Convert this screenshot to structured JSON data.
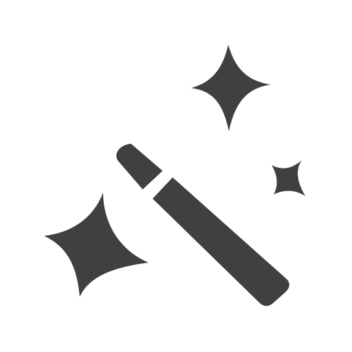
{
  "icon": {
    "name": "magic-wand-sparkles-icon",
    "color": "#404040",
    "background": "#ffffff"
  }
}
